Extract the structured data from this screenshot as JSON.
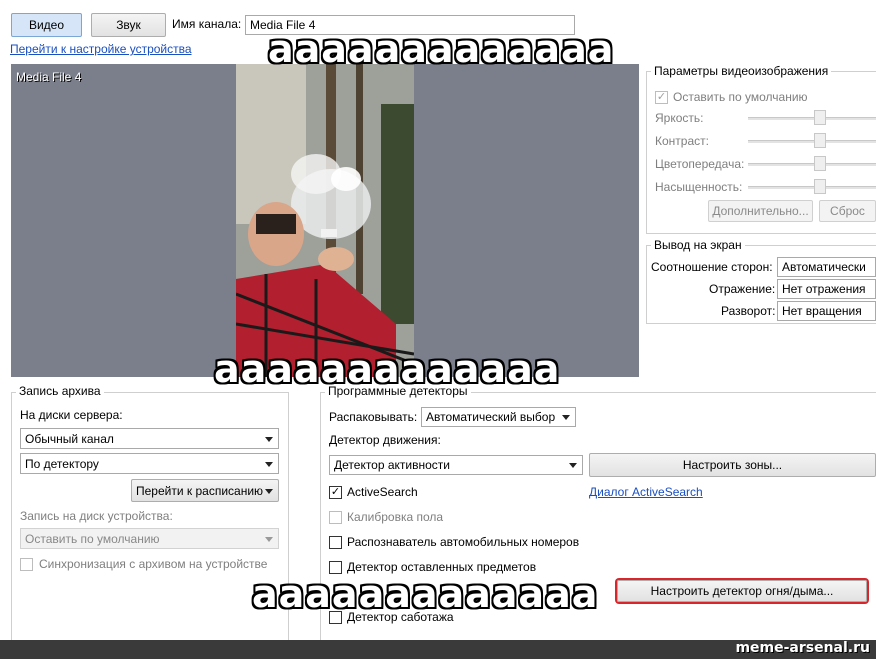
{
  "tabs": {
    "video": "Видео",
    "sound": "Звук"
  },
  "channel": {
    "label": "Имя канала:",
    "value": "Media File 4"
  },
  "device_link": "Перейти к настройке устройства",
  "preview": {
    "overlay_title": "Media File 4",
    "bg_color": "#7b7f8c"
  },
  "image_params": {
    "title": "Параметры видеоизображения",
    "default_checkbox": "Оставить по умолчанию",
    "brightness": "Яркость:",
    "contrast": "Контраст:",
    "color": "Цветопередача:",
    "saturation": "Насыщенность:",
    "more_button": "Дополнительно...",
    "reset_button": "Сброс"
  },
  "display": {
    "title": "Вывод на экран",
    "aspect_label": "Соотношение сторон:",
    "aspect_value": "Автоматически",
    "mirror_label": "Отражение:",
    "mirror_value": "Нет отражения",
    "rotate_label": "Разворот:",
    "rotate_value": "Нет вращения"
  },
  "archive": {
    "title": "Запись архива",
    "server_disks_label": "На диски сервера:",
    "channel_select": "Обычный канал",
    "detector_select": "По детектору",
    "schedule_button": "Перейти к расписанию",
    "device_disk_label": "Запись на диск устройства:",
    "device_select": "Оставить по умолчанию",
    "sync_checkbox": "Синхронизация с архивом на устройстве"
  },
  "detectors": {
    "title": "Программные детекторы",
    "unpack_label": "Распаковывать:",
    "unpack_value": "Автоматический выбор",
    "motion_label": "Детектор движения:",
    "motion_value": "Детектор активности",
    "zones_button": "Настроить зоны...",
    "activesearch": "ActiveSearch",
    "activesearch_link": "Диалог ActiveSearch",
    "calibration": "Калибровка пола",
    "plates": "Распознаватель автомобильных номеров",
    "left_items": "Детектор оставленных предметов",
    "fire_button": "Настроить детектор огня/дыма...",
    "sabotage": "Детектор саботажа"
  },
  "meme": {
    "caption_top": "ааааааааааааа",
    "caption_middle": "ааааааааааааа",
    "caption_bottom": "ааааааааааааа",
    "watermark": "meme-arsenal.ru"
  },
  "colors": {
    "highlight": "#d9262b",
    "link": "#1a4fc0"
  }
}
